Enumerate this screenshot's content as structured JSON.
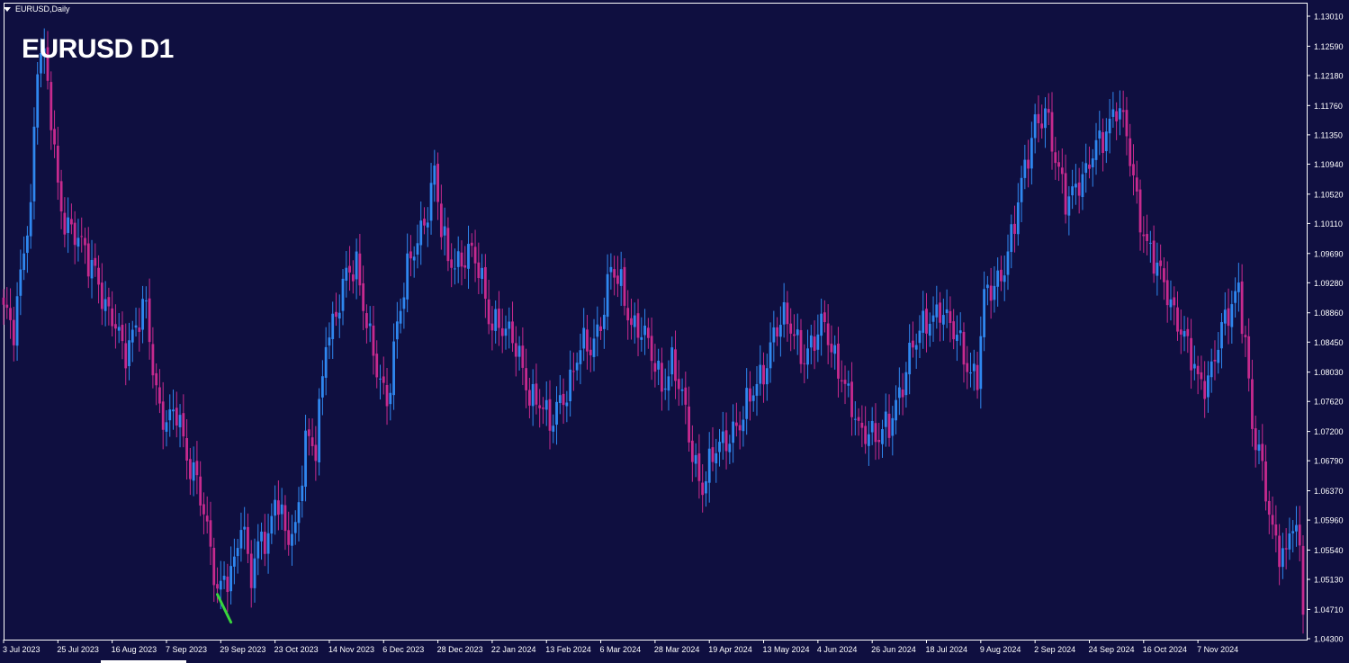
{
  "window": {
    "symbol_label": "EURUSD,Daily"
  },
  "title": "EURUSD D1",
  "colors": {
    "background": "#0f0f40",
    "bull": "#2f87ef",
    "bear": "#c62a8e",
    "axis": "#ffffff",
    "marker": "#39d53c"
  },
  "chart_data": {
    "type": "candlestick",
    "title": "EURUSD D1",
    "ylim": [
      1.0418,
      1.1335
    ],
    "y_ticks": [
      "1.13010",
      "1.12590",
      "1.12180",
      "1.11760",
      "1.11350",
      "1.10940",
      "1.10520",
      "1.10110",
      "1.09690",
      "1.09280",
      "1.08860",
      "1.08450",
      "1.08030",
      "1.07620",
      "1.07200",
      "1.06790",
      "1.06370",
      "1.05960",
      "1.05540",
      "1.05130",
      "1.04710",
      "1.04300"
    ],
    "x_ticks": [
      {
        "label": "3 Jul 2023",
        "index": 0
      },
      {
        "label": "25 Jul 2023",
        "index": 16
      },
      {
        "label": "16 Aug 2023",
        "index": 32
      },
      {
        "label": "7 Sep 2023",
        "index": 48
      },
      {
        "label": "29 Sep 2023",
        "index": 64
      },
      {
        "label": "23 Oct 2023",
        "index": 80
      },
      {
        "label": "14 Nov 2023",
        "index": 96
      },
      {
        "label": "6 Dec 2023",
        "index": 112
      },
      {
        "label": "28 Dec 2023",
        "index": 128
      },
      {
        "label": "22 Jan 2024",
        "index": 144
      },
      {
        "label": "13 Feb 2024",
        "index": 160
      },
      {
        "label": "6 Mar 2024",
        "index": 176
      },
      {
        "label": "28 Mar 2024",
        "index": 192
      },
      {
        "label": "19 Apr 2024",
        "index": 208
      },
      {
        "label": "13 May 2024",
        "index": 224
      },
      {
        "label": "4 Jun 2024",
        "index": 240
      },
      {
        "label": "26 Jun 2024",
        "index": 256
      },
      {
        "label": "18 Jul 2024",
        "index": 272
      },
      {
        "label": "9 Aug 2024",
        "index": 288
      },
      {
        "label": "2 Sep 2024",
        "index": 304
      },
      {
        "label": "24 Sep 2024",
        "index": 320
      },
      {
        "label": "16 Oct 2024",
        "index": 336
      },
      {
        "label": "7 Nov 2024",
        "index": 352
      }
    ],
    "close_path": [
      {
        "i": 0,
        "c": 1.088
      },
      {
        "i": 3,
        "c": 1.086
      },
      {
        "i": 6,
        "c": 1.099
      },
      {
        "i": 8,
        "c": 1.103
      },
      {
        "i": 10,
        "c": 1.123
      },
      {
        "i": 12,
        "c": 1.124
      },
      {
        "i": 14,
        "c": 1.117
      },
      {
        "i": 16,
        "c": 1.107
      },
      {
        "i": 18,
        "c": 1.101
      },
      {
        "i": 20,
        "c": 1.099
      },
      {
        "i": 24,
        "c": 1.098
      },
      {
        "i": 27,
        "c": 1.095
      },
      {
        "i": 30,
        "c": 1.088
      },
      {
        "i": 33,
        "c": 1.087
      },
      {
        "i": 36,
        "c": 1.084
      },
      {
        "i": 39,
        "c": 1.086
      },
      {
        "i": 42,
        "c": 1.089
      },
      {
        "i": 45,
        "c": 1.078
      },
      {
        "i": 48,
        "c": 1.073
      },
      {
        "i": 51,
        "c": 1.074
      },
      {
        "i": 54,
        "c": 1.069
      },
      {
        "i": 57,
        "c": 1.066
      },
      {
        "i": 60,
        "c": 1.057
      },
      {
        "i": 62,
        "c": 1.052
      },
      {
        "i": 63,
        "c": 1.049
      },
      {
        "i": 65,
        "c": 1.053
      },
      {
        "i": 67,
        "c": 1.052
      },
      {
        "i": 70,
        "c": 1.058
      },
      {
        "i": 73,
        "c": 1.052
      },
      {
        "i": 76,
        "c": 1.059
      },
      {
        "i": 78,
        "c": 1.056
      },
      {
        "i": 80,
        "c": 1.062
      },
      {
        "i": 83,
        "c": 1.058
      },
      {
        "i": 86,
        "c": 1.059
      },
      {
        "i": 89,
        "c": 1.07
      },
      {
        "i": 92,
        "c": 1.069
      },
      {
        "i": 95,
        "c": 1.086
      },
      {
        "i": 98,
        "c": 1.088
      },
      {
        "i": 101,
        "c": 1.093
      },
      {
        "i": 104,
        "c": 1.096
      },
      {
        "i": 107,
        "c": 1.088
      },
      {
        "i": 109,
        "c": 1.082
      },
      {
        "i": 111,
        "c": 1.078
      },
      {
        "i": 113,
        "c": 1.076
      },
      {
        "i": 116,
        "c": 1.088
      },
      {
        "i": 119,
        "c": 1.094
      },
      {
        "i": 122,
        "c": 1.098
      },
      {
        "i": 125,
        "c": 1.104
      },
      {
        "i": 127,
        "c": 1.109
      },
      {
        "i": 129,
        "c": 1.1
      },
      {
        "i": 131,
        "c": 1.095
      },
      {
        "i": 134,
        "c": 1.096
      },
      {
        "i": 137,
        "c": 1.098
      },
      {
        "i": 140,
        "c": 1.094
      },
      {
        "i": 143,
        "c": 1.088
      },
      {
        "i": 146,
        "c": 1.088
      },
      {
        "i": 149,
        "c": 1.085
      },
      {
        "i": 152,
        "c": 1.082
      },
      {
        "i": 155,
        "c": 1.078
      },
      {
        "i": 158,
        "c": 1.076
      },
      {
        "i": 161,
        "c": 1.072
      },
      {
        "i": 164,
        "c": 1.077
      },
      {
        "i": 167,
        "c": 1.079
      },
      {
        "i": 170,
        "c": 1.083
      },
      {
        "i": 173,
        "c": 1.084
      },
      {
        "i": 176,
        "c": 1.088
      },
      {
        "i": 179,
        "c": 1.094
      },
      {
        "i": 182,
        "c": 1.092
      },
      {
        "i": 185,
        "c": 1.088
      },
      {
        "i": 188,
        "c": 1.086
      },
      {
        "i": 191,
        "c": 1.082
      },
      {
        "i": 194,
        "c": 1.079
      },
      {
        "i": 197,
        "c": 1.082
      },
      {
        "i": 200,
        "c": 1.076
      },
      {
        "i": 203,
        "c": 1.069
      },
      {
        "i": 206,
        "c": 1.065
      },
      {
        "i": 209,
        "c": 1.068
      },
      {
        "i": 212,
        "c": 1.07
      },
      {
        "i": 215,
        "c": 1.073
      },
      {
        "i": 218,
        "c": 1.074
      },
      {
        "i": 221,
        "c": 1.077
      },
      {
        "i": 224,
        "c": 1.081
      },
      {
        "i": 227,
        "c": 1.086
      },
      {
        "i": 230,
        "c": 1.087
      },
      {
        "i": 233,
        "c": 1.086
      },
      {
        "i": 236,
        "c": 1.083
      },
      {
        "i": 239,
        "c": 1.084
      },
      {
        "i": 242,
        "c": 1.087
      },
      {
        "i": 245,
        "c": 1.083
      },
      {
        "i": 247,
        "c": 1.08
      },
      {
        "i": 249,
        "c": 1.076
      },
      {
        "i": 252,
        "c": 1.072
      },
      {
        "i": 255,
        "c": 1.073
      },
      {
        "i": 258,
        "c": 1.071
      },
      {
        "i": 261,
        "c": 1.072
      },
      {
        "i": 264,
        "c": 1.078
      },
      {
        "i": 267,
        "c": 1.083
      },
      {
        "i": 270,
        "c": 1.085
      },
      {
        "i": 273,
        "c": 1.088
      },
      {
        "i": 276,
        "c": 1.09
      },
      {
        "i": 279,
        "c": 1.086
      },
      {
        "i": 282,
        "c": 1.084
      },
      {
        "i": 285,
        "c": 1.081
      },
      {
        "i": 287,
        "c": 1.08
      },
      {
        "i": 289,
        "c": 1.09
      },
      {
        "i": 292,
        "c": 1.092
      },
      {
        "i": 295,
        "c": 1.096
      },
      {
        "i": 298,
        "c": 1.101
      },
      {
        "i": 301,
        "c": 1.108
      },
      {
        "i": 304,
        "c": 1.116
      },
      {
        "i": 307,
        "c": 1.117
      },
      {
        "i": 310,
        "c": 1.109
      },
      {
        "i": 313,
        "c": 1.105
      },
      {
        "i": 316,
        "c": 1.107
      },
      {
        "i": 319,
        "c": 1.107
      },
      {
        "i": 322,
        "c": 1.112
      },
      {
        "i": 325,
        "c": 1.115
      },
      {
        "i": 328,
        "c": 1.117
      },
      {
        "i": 331,
        "c": 1.113
      },
      {
        "i": 334,
        "c": 1.105
      },
      {
        "i": 337,
        "c": 1.098
      },
      {
        "i": 340,
        "c": 1.094
      },
      {
        "i": 343,
        "c": 1.092
      },
      {
        "i": 346,
        "c": 1.088
      },
      {
        "i": 349,
        "c": 1.083
      },
      {
        "i": 352,
        "c": 1.079
      },
      {
        "i": 355,
        "c": 1.08
      },
      {
        "i": 358,
        "c": 1.084
      },
      {
        "i": 361,
        "c": 1.088
      },
      {
        "i": 364,
        "c": 1.093
      },
      {
        "i": 366,
        "c": 1.085
      },
      {
        "i": 368,
        "c": 1.072
      },
      {
        "i": 371,
        "c": 1.066
      },
      {
        "i": 374,
        "c": 1.059
      },
      {
        "i": 376,
        "c": 1.056
      },
      {
        "i": 378,
        "c": 1.054
      },
      {
        "i": 380,
        "c": 1.059
      },
      {
        "i": 382,
        "c": 1.055
      },
      {
        "i": 383,
        "c": 1.048
      }
    ],
    "marker_segment": {
      "from": {
        "i": 63,
        "v": 1.0492
      },
      "to": {
        "i": 67,
        "v": 1.0453
      }
    }
  }
}
